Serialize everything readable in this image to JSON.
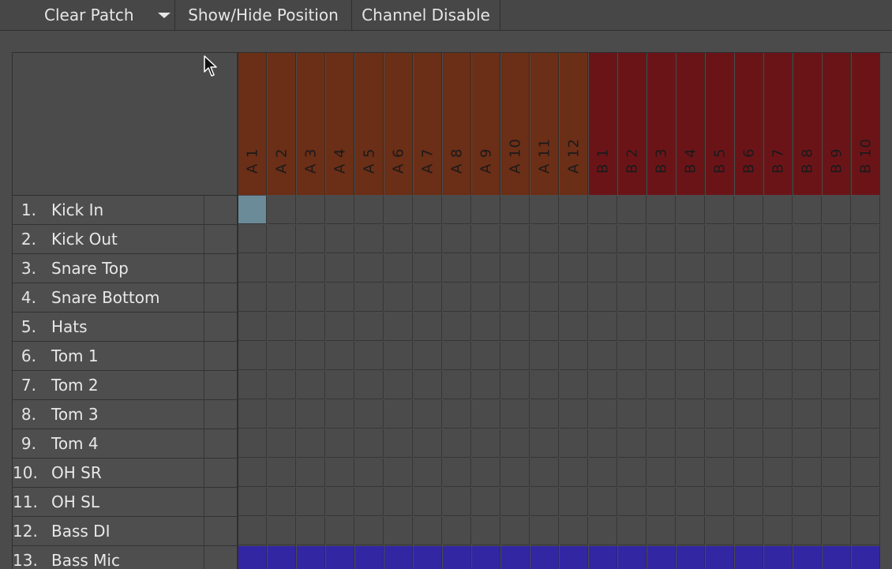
{
  "toolbar": {
    "clear_patch": "Clear Patch",
    "show_hide_position": "Show/Hide Position",
    "channel_disable": "Channel Disable"
  },
  "colors": {
    "bank_a": "#6b2e16",
    "bank_b": "#6b1418",
    "active_cell": "#6b8b99",
    "bass_mic_row": "#3326a3"
  },
  "columns": [
    "A 1",
    "A 2",
    "A 3",
    "A 4",
    "A 5",
    "A 6",
    "A 7",
    "A 8",
    "A 9",
    "A 10",
    "A 11",
    "A 12",
    "B 1",
    "B 2",
    "B 3",
    "B 4",
    "B 5",
    "B 6",
    "B 7",
    "B 8",
    "B 9",
    "B 10"
  ],
  "rows": [
    {
      "num": "1.",
      "name": "Kick In"
    },
    {
      "num": "2.",
      "name": "Kick Out"
    },
    {
      "num": "3.",
      "name": "Snare Top"
    },
    {
      "num": "4.",
      "name": "Snare Bottom"
    },
    {
      "num": "5.",
      "name": "Hats"
    },
    {
      "num": "6.",
      "name": "Tom 1"
    },
    {
      "num": "7.",
      "name": "Tom 2"
    },
    {
      "num": "8.",
      "name": "Tom 3"
    },
    {
      "num": "9.",
      "name": "Tom 4"
    },
    {
      "num": "10.",
      "name": "OH SR"
    },
    {
      "num": "11.",
      "name": "OH SL"
    },
    {
      "num": "12.",
      "name": "Bass DI"
    },
    {
      "num": "13.",
      "name": "Bass Mic"
    }
  ],
  "active_patch": {
    "row": 0,
    "col": 0
  }
}
